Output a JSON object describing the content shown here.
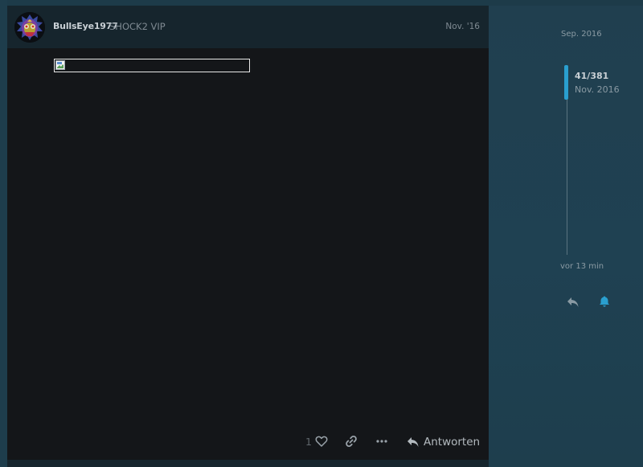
{
  "post": {
    "username": "BullsEye1977",
    "user_title": "SHOCK2 VIP",
    "date": "Nov. '16",
    "avatar_icon": "majora-mask-avatar",
    "content": {
      "image_icon": "broken-image-icon"
    },
    "actions": {
      "like_count": "1",
      "like_icon": "heart-icon",
      "link_icon": "link-icon",
      "more_icon": "ellipsis-icon",
      "reply_icon": "reply-icon",
      "reply_label": "Antworten"
    }
  },
  "timeline": {
    "start_label": "Sep. 2016",
    "position": "41/381",
    "current_date": "Nov. 2016",
    "end_label": "vor 13 min",
    "reply_icon": "reply-icon",
    "notification_icon": "bell-icon",
    "accent_color": "#2a9fcf"
  }
}
